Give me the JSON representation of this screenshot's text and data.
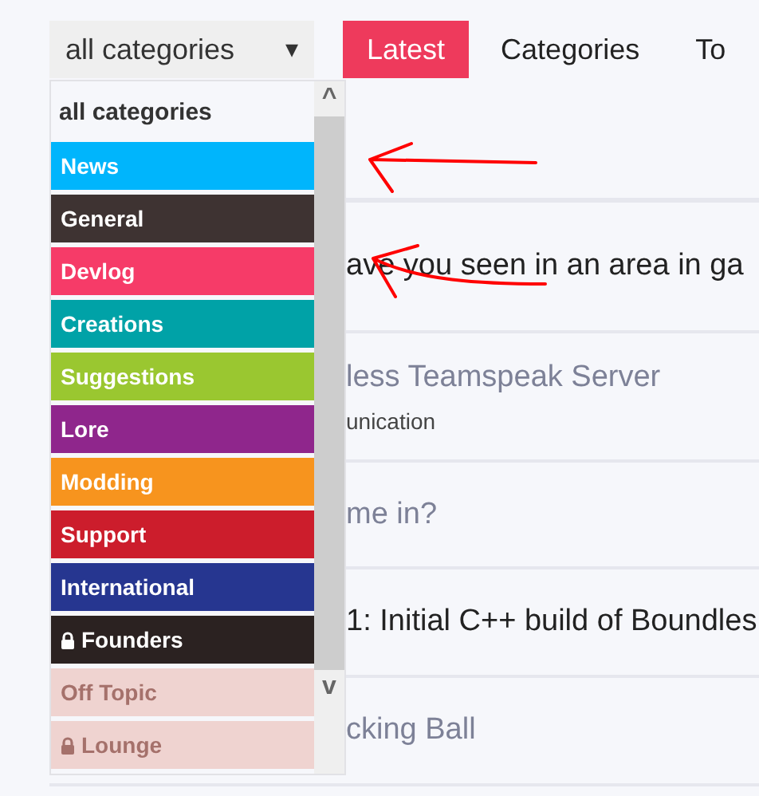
{
  "category_select": {
    "value": "all categories",
    "caret": "▾"
  },
  "nav_tabs": [
    {
      "label": "Latest",
      "selected": true
    },
    {
      "label": "Categories",
      "selected": false
    },
    {
      "label": "To",
      "selected": false
    }
  ],
  "category_menu": {
    "header": "all categories",
    "scroll_up": "^",
    "scroll_down": "v",
    "items": [
      {
        "label": "News",
        "color": "#00b5fc",
        "locked": false
      },
      {
        "label": "General",
        "color": "#3e3332",
        "locked": false
      },
      {
        "label": "Devlog",
        "color": "#f63b68",
        "locked": false
      },
      {
        "label": "Creations",
        "color": "#00a2a7",
        "locked": false
      },
      {
        "label": "Suggestions",
        "color": "#9ac730",
        "locked": false
      },
      {
        "label": "Lore",
        "color": "#8f268c",
        "locked": false
      },
      {
        "label": "Modding",
        "color": "#f7941e",
        "locked": false
      },
      {
        "label": "Support",
        "color": "#cc1d2c",
        "locked": false
      },
      {
        "label": "International",
        "color": "#263690",
        "locked": false
      },
      {
        "label": "Founders",
        "color": "#2b2221",
        "locked": true
      },
      {
        "label": "Off Topic",
        "color": "#efd3d0",
        "locked": false
      },
      {
        "label": "Lounge",
        "color": "#efd3d0",
        "locked": true
      }
    ]
  },
  "topics": [
    {
      "title": "ave you seen in an area in ga",
      "visited": false
    },
    {
      "title": "less Teamspeak Server",
      "visited": true,
      "category": "unication"
    },
    {
      "title": "me in?",
      "visited": true
    },
    {
      "title": "1: Initial C++ build of Boundles",
      "visited": false
    },
    {
      "title": "cking Ball",
      "visited": true
    }
  ],
  "annotations": [
    {
      "kind": "arrow"
    },
    {
      "kind": "arrow"
    }
  ]
}
